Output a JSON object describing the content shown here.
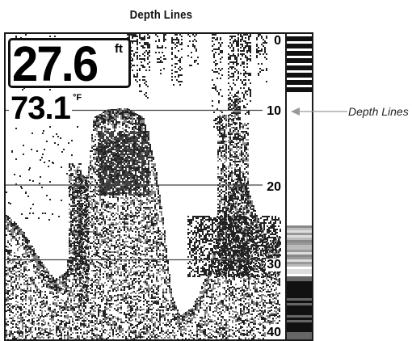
{
  "caption": {
    "title": "Depth Lines",
    "callout_label": "Depth Lines"
  },
  "readouts": {
    "depth_value": "27.6",
    "depth_unit": "ft",
    "temperature_value": "73.1",
    "temperature_unit": "°F"
  },
  "depth_scale": {
    "labels": [
      "0",
      "10",
      "20",
      "30",
      "40"
    ],
    "min": 0,
    "max": 40,
    "depth_lines": [
      10,
      20,
      30
    ]
  },
  "colors": {
    "sonar_return": "#222222",
    "depth_line": "#444444",
    "callout_arrow": "#9a9a9a",
    "screen_bg": "#ffffff"
  }
}
